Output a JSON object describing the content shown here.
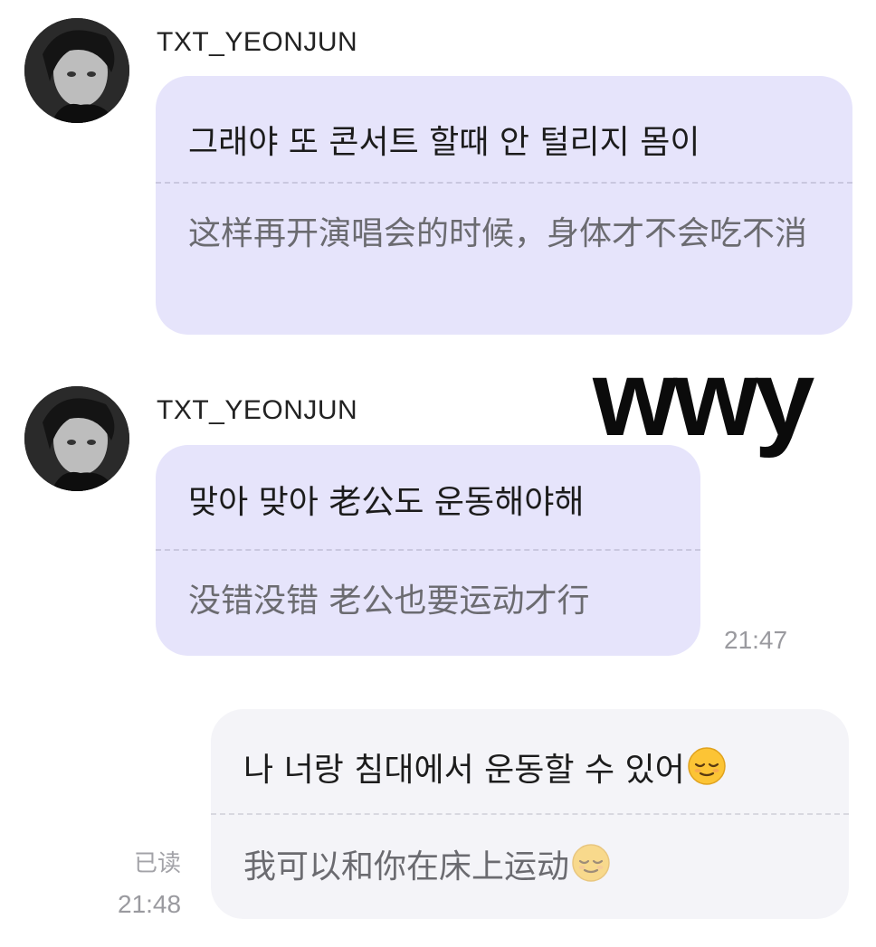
{
  "messages": [
    {
      "sender": "TXT_YEONJUN",
      "original": "그래야 또 콘서트 할때 안 털리지 몸이",
      "translation": "这样再开演唱会的时候，身体才不会吃不消"
    },
    {
      "sender": "TXT_YEONJUN",
      "original": "맞아 맞아 老公도 운동해야해",
      "translation": "没错没错 老公也要运动才行",
      "time": "21:47"
    },
    {
      "original": "나 너랑 침대에서 운동할 수 있어",
      "translation": "我可以和你在床上运动",
      "read_status": "已读",
      "time": "21:48",
      "emoji": "relieved-face-emoji"
    }
  ],
  "watermark": "wwy",
  "colors": {
    "incoming_bubble": "#e6e4fb",
    "outgoing_bubble": "#f4f4f8",
    "translation_text": "#6b6b70",
    "time_text": "#9a9a9f"
  }
}
